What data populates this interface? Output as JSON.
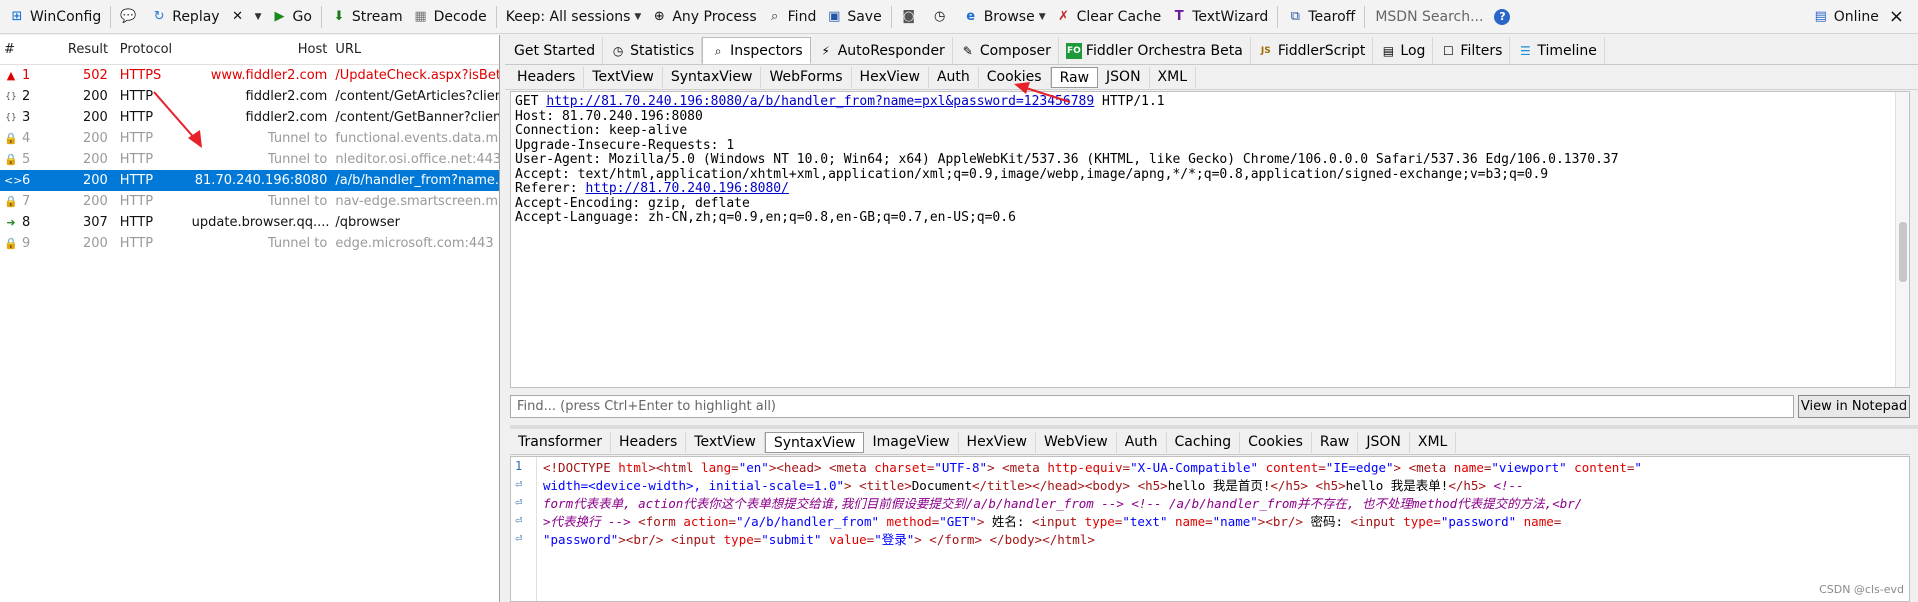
{
  "toolbar": {
    "items": [
      {
        "label": "WinConfig",
        "icon": "windows-icon"
      },
      {
        "label": "Replay",
        "icon": "replay-icon"
      },
      {
        "label": "Go",
        "icon": "go-icon"
      },
      {
        "label": "Stream",
        "icon": "stream-icon"
      },
      {
        "label": "Decode",
        "icon": "decode-icon"
      },
      {
        "label": "Keep: All sessions",
        "icon": ""
      },
      {
        "label": "Any Process",
        "icon": "crosshair-icon"
      },
      {
        "label": "Find",
        "icon": "binoculars-icon"
      },
      {
        "label": "Save",
        "icon": "save-icon"
      },
      {
        "label": "Browse",
        "icon": "ie-icon"
      },
      {
        "label": "Clear Cache",
        "icon": "clear-icon"
      },
      {
        "label": "TextWizard",
        "icon": "textwizard-icon"
      },
      {
        "label": "Tearoff",
        "icon": "tearoff-icon"
      }
    ],
    "search_placeholder": "MSDN Search...",
    "online_label": "Online",
    "close_label": "×",
    "remove_label": "✕"
  },
  "sessions": {
    "headers": {
      "num": "#",
      "result": "Result",
      "protocol": "Protocol",
      "host": "Host",
      "url": "URL"
    },
    "rows": [
      {
        "num": "1",
        "result": "502",
        "protocol": "HTTPS",
        "host": "www.fiddler2.com",
        "url": "/UpdateCheck.aspx?isBet",
        "state": "error",
        "icon": "warning-icon"
      },
      {
        "num": "2",
        "result": "200",
        "protocol": "HTTP",
        "host": "fiddler2.com",
        "url": "/content/GetArticles?clien",
        "state": "normal",
        "icon": "json-icon"
      },
      {
        "num": "3",
        "result": "200",
        "protocol": "HTTP",
        "host": "fiddler2.com",
        "url": "/content/GetBanner?clien",
        "state": "normal",
        "icon": "json-icon"
      },
      {
        "num": "4",
        "result": "200",
        "protocol": "HTTP",
        "host": "Tunnel to",
        "url": "functional.events.data.m",
        "state": "tunnel",
        "icon": "lock-icon"
      },
      {
        "num": "5",
        "result": "200",
        "protocol": "HTTP",
        "host": "Tunnel to",
        "url": "nleditor.osi.office.net:443",
        "state": "tunnel",
        "icon": "lock-icon"
      },
      {
        "num": "6",
        "result": "200",
        "protocol": "HTTP",
        "host": "81.70.240.196:8080",
        "url": "/a/b/handler_from?name.",
        "state": "selected",
        "icon": "html-icon"
      },
      {
        "num": "7",
        "result": "200",
        "protocol": "HTTP",
        "host": "Tunnel to",
        "url": "nav-edge.smartscreen.mi",
        "state": "tunnel",
        "icon": "lock-icon"
      },
      {
        "num": "8",
        "result": "307",
        "protocol": "HTTP",
        "host": "update.browser.qq....",
        "url": "/qbrowser",
        "state": "normal",
        "icon": "redirect-icon"
      },
      {
        "num": "9",
        "result": "200",
        "protocol": "HTTP",
        "host": "Tunnel to",
        "url": "edge.microsoft.com:443",
        "state": "tunnel",
        "icon": "lock-icon"
      }
    ]
  },
  "main_tabs": [
    {
      "label": "Get Started",
      "icon": ""
    },
    {
      "label": "Statistics",
      "icon": "statistics-icon"
    },
    {
      "label": "Inspectors",
      "icon": "inspectors-icon",
      "active": true
    },
    {
      "label": "AutoResponder",
      "icon": "autoresponder-icon"
    },
    {
      "label": "Composer",
      "icon": "composer-icon"
    },
    {
      "label": "Fiddler Orchestra Beta",
      "icon": "fo-icon"
    },
    {
      "label": "FiddlerScript",
      "icon": "js-icon"
    },
    {
      "label": "Log",
      "icon": "log-icon"
    },
    {
      "label": "Filters",
      "icon": "filters-icon"
    },
    {
      "label": "Timeline",
      "icon": "timeline-icon"
    }
  ],
  "request_tabs": [
    "Headers",
    "TextView",
    "SyntaxView",
    "WebForms",
    "HexView",
    "Auth",
    "Cookies",
    "Raw",
    "JSON",
    "XML"
  ],
  "request_active": "Raw",
  "request_raw": {
    "line1_method": "GET ",
    "line1_url": "http://81.70.240.196:8080/a/b/handler_from?name=pxl&password=123456789",
    "line1_version": " HTTP/1.1",
    "lines": [
      "Host: 81.70.240.196:8080",
      "Connection: keep-alive",
      "Upgrade-Insecure-Requests: 1",
      "User-Agent: Mozilla/5.0 (Windows NT 10.0; Win64; x64) AppleWebKit/537.36 (KHTML, like Gecko) Chrome/106.0.0.0 Safari/537.36 Edg/106.0.1370.37",
      "Accept: text/html,application/xhtml+xml,application/xml;q=0.9,image/webp,image/apng,*/*;q=0.8,application/signed-exchange;v=b3;q=0.9"
    ],
    "referer_label": "Referer: ",
    "referer_url": "http://81.70.240.196:8080/",
    "lines_after": [
      "Accept-Encoding: gzip, deflate",
      "Accept-Language: zh-CN,zh;q=0.9,en;q=0.8,en-GB;q=0.7,en-US;q=0.6"
    ]
  },
  "find": {
    "placeholder": "Find... (press Ctrl+Enter to highlight all)",
    "button": "View in Notepad"
  },
  "response_tabs": [
    "Transformer",
    "Headers",
    "TextView",
    "SyntaxView",
    "ImageView",
    "HexView",
    "WebView",
    "Auth",
    "Caching",
    "Cookies",
    "Raw",
    "JSON",
    "XML"
  ],
  "response_active": "SyntaxView",
  "response_code": {
    "gutter": [
      "1",
      "⏎",
      "⏎",
      "⏎",
      "⏎"
    ],
    "line1": [
      {
        "t": "<!DOCTYPE ",
        "c": "tag"
      },
      {
        "t": "html",
        "c": "attr"
      },
      {
        "t": ">",
        "c": "tag"
      },
      {
        "t": "<html ",
        "c": "tag"
      },
      {
        "t": "lang",
        "c": "attr"
      },
      {
        "t": "=",
        "c": "tag"
      },
      {
        "t": "\"en\"",
        "c": "val"
      },
      {
        "t": "><head>",
        "c": "tag"
      },
      {
        "t": "    <meta ",
        "c": "tag"
      },
      {
        "t": "charset",
        "c": "attr"
      },
      {
        "t": "=",
        "c": "tag"
      },
      {
        "t": "\"UTF-8\"",
        "c": "val"
      },
      {
        "t": ">",
        "c": "tag"
      },
      {
        "t": "    <meta ",
        "c": "tag"
      },
      {
        "t": "http-equiv",
        "c": "attr"
      },
      {
        "t": "=",
        "c": "tag"
      },
      {
        "t": "\"X-UA-Compatible\"",
        "c": "val"
      },
      {
        "t": " content",
        "c": "attr"
      },
      {
        "t": "=",
        "c": "tag"
      },
      {
        "t": "\"IE=edge\"",
        "c": "val"
      },
      {
        "t": ">",
        "c": "tag"
      },
      {
        "t": "    <meta ",
        "c": "tag"
      },
      {
        "t": "name",
        "c": "attr"
      },
      {
        "t": "=",
        "c": "tag"
      },
      {
        "t": "\"viewport\"",
        "c": "val"
      },
      {
        "t": " content",
        "c": "attr"
      },
      {
        "t": "=",
        "c": "tag"
      },
      {
        "t": "\"",
        "c": "val"
      }
    ],
    "line2": [
      {
        "t": "width=<device-width>, initial-scale=1.0\"",
        "c": "val"
      },
      {
        "t": ">",
        "c": "tag"
      },
      {
        "t": "    <title>",
        "c": "tag"
      },
      {
        "t": "Document",
        "c": "txt"
      },
      {
        "t": "</title></head><body>",
        "c": "tag"
      },
      {
        "t": "    <h5>",
        "c": "tag"
      },
      {
        "t": "hello 我是首页!",
        "c": "txt"
      },
      {
        "t": "</h5>",
        "c": "tag"
      },
      {
        "t": "    <h5>",
        "c": "tag"
      },
      {
        "t": "hello 我是表单!",
        "c": "txt"
      },
      {
        "t": "</h5>",
        "c": "tag"
      },
      {
        "t": "    <!--",
        "c": "cmt"
      }
    ],
    "line3": [
      {
        "t": "form代表表单, action代表你这个表单想提交给谁,我们目前假设要提交到/a/b/handler_from -->    <!-- /a/b/handler_from并不存在, 也不处理method代表提交的方法,<br/",
        "c": "cmt"
      }
    ],
    "line4": [
      {
        "t": ">代表换行 -->",
        "c": "cmt"
      },
      {
        "t": "    <form ",
        "c": "tag"
      },
      {
        "t": "action",
        "c": "attr"
      },
      {
        "t": "=",
        "c": "tag"
      },
      {
        "t": "\"/a/b/handler_from\"",
        "c": "val"
      },
      {
        "t": " method",
        "c": "attr"
      },
      {
        "t": "=",
        "c": "tag"
      },
      {
        "t": "\"GET\"",
        "c": "val"
      },
      {
        "t": ">",
        "c": "tag"
      },
      {
        "t": "        姓名: ",
        "c": "txt"
      },
      {
        "t": "<input ",
        "c": "tag"
      },
      {
        "t": "type",
        "c": "attr"
      },
      {
        "t": "=",
        "c": "tag"
      },
      {
        "t": "\"text\"",
        "c": "val"
      },
      {
        "t": " name",
        "c": "attr"
      },
      {
        "t": "=",
        "c": "tag"
      },
      {
        "t": "\"name\"",
        "c": "val"
      },
      {
        "t": "><br/>",
        "c": "tag"
      },
      {
        "t": "        密码: ",
        "c": "txt"
      },
      {
        "t": "<input ",
        "c": "tag"
      },
      {
        "t": "type",
        "c": "attr"
      },
      {
        "t": "=",
        "c": "tag"
      },
      {
        "t": "\"password\"",
        "c": "val"
      },
      {
        "t": " name",
        "c": "attr"
      },
      {
        "t": "=",
        "c": "tag"
      }
    ],
    "line5": [
      {
        "t": "\"password\"",
        "c": "val"
      },
      {
        "t": "><br/>",
        "c": "tag"
      },
      {
        "t": "        <input ",
        "c": "tag"
      },
      {
        "t": "type",
        "c": "attr"
      },
      {
        "t": "=",
        "c": "tag"
      },
      {
        "t": "\"submit\"",
        "c": "val"
      },
      {
        "t": " value",
        "c": "attr"
      },
      {
        "t": "=",
        "c": "tag"
      },
      {
        "t": "\"登录\"",
        "c": "val"
      },
      {
        "t": ">",
        "c": "tag"
      },
      {
        "t": "    </form>",
        "c": "tag"
      },
      {
        "t": "    </body></html>",
        "c": "tag"
      }
    ]
  },
  "watermark": "CSDN @cls-evd",
  "colors": {
    "accent": "#0078d7",
    "error": "#e00000",
    "annotation_arrow": "#e8202a"
  }
}
